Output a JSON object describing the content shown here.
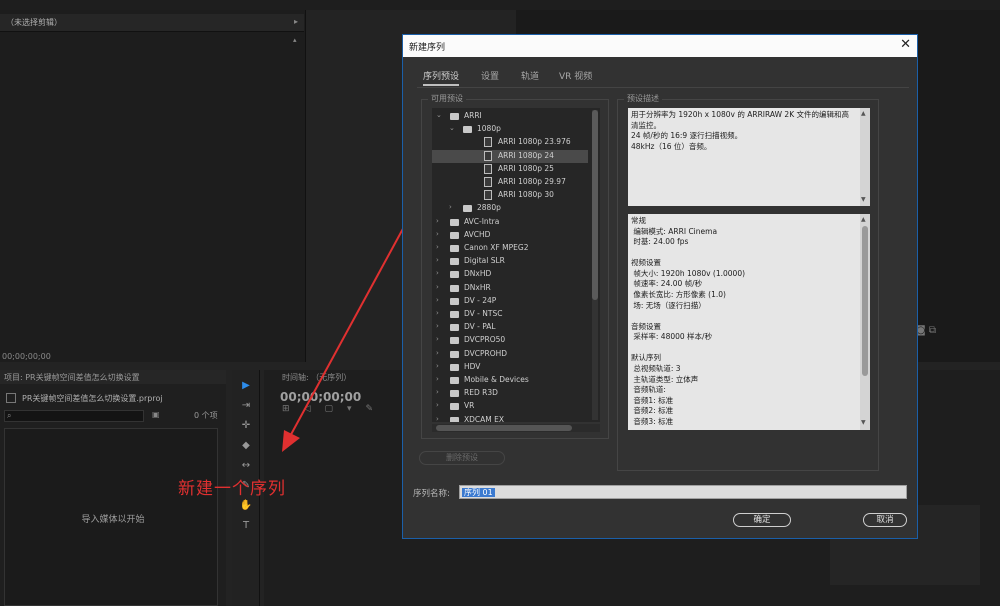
{
  "source_panel": {
    "tab_label": "（未选择剪辑）",
    "timecode": "00;00;00;00"
  },
  "project_panel": {
    "tab_label": "项目: PR关键帧空间差值怎么切换设置",
    "file_name": "PR关键帧空间差值怎么切换设置.prproj",
    "item_count": "0 个项",
    "empty_text": "导入媒体以开始"
  },
  "timeline": {
    "tab_label": "时间轴: （无序列）",
    "timecode": "00;00;00;00"
  },
  "annotation": {
    "text": "新建一个序列",
    "color": "#e03030"
  },
  "dialog": {
    "title": "新建序列",
    "tabs": [
      "序列预设",
      "设置",
      "轨道",
      "VR 视频"
    ],
    "active_tab": 0,
    "available_presets_label": "可用预设",
    "description_label": "预设描述",
    "tree": [
      {
        "label": "ARRI",
        "type": "folder",
        "level": 0,
        "expanded": true
      },
      {
        "label": "1080p",
        "type": "folder",
        "level": 1,
        "expanded": true
      },
      {
        "label": "ARRI 1080p 23.976",
        "type": "file",
        "level": 2
      },
      {
        "label": "ARRI 1080p 24",
        "type": "file",
        "level": 2,
        "selected": true
      },
      {
        "label": "ARRI 1080p 25",
        "type": "file",
        "level": 2
      },
      {
        "label": "ARRI 1080p 29.97",
        "type": "file",
        "level": 2
      },
      {
        "label": "ARRI 1080p 30",
        "type": "file",
        "level": 2
      },
      {
        "label": "2880p",
        "type": "folder",
        "level": 1,
        "expanded": false
      },
      {
        "label": "AVC-Intra",
        "type": "folder",
        "level": 0,
        "expanded": false
      },
      {
        "label": "AVCHD",
        "type": "folder",
        "level": 0,
        "expanded": false
      },
      {
        "label": "Canon XF MPEG2",
        "type": "folder",
        "level": 0,
        "expanded": false
      },
      {
        "label": "Digital SLR",
        "type": "folder",
        "level": 0,
        "expanded": false
      },
      {
        "label": "DNxHD",
        "type": "folder",
        "level": 0,
        "expanded": false
      },
      {
        "label": "DNxHR",
        "type": "folder",
        "level": 0,
        "expanded": false
      },
      {
        "label": "DV - 24P",
        "type": "folder",
        "level": 0,
        "expanded": false
      },
      {
        "label": "DV - NTSC",
        "type": "folder",
        "level": 0,
        "expanded": false
      },
      {
        "label": "DV - PAL",
        "type": "folder",
        "level": 0,
        "expanded": false
      },
      {
        "label": "DVCPRO50",
        "type": "folder",
        "level": 0,
        "expanded": false
      },
      {
        "label": "DVCPROHD",
        "type": "folder",
        "level": 0,
        "expanded": false
      },
      {
        "label": "HDV",
        "type": "folder",
        "level": 0,
        "expanded": false
      },
      {
        "label": "Mobile & Devices",
        "type": "folder",
        "level": 0,
        "expanded": false
      },
      {
        "label": "RED R3D",
        "type": "folder",
        "level": 0,
        "expanded": false
      },
      {
        "label": "VR",
        "type": "folder",
        "level": 0,
        "expanded": false
      },
      {
        "label": "XDCAM EX",
        "type": "folder",
        "level": 0,
        "expanded": false
      }
    ],
    "description_lines": [
      "用于分辨率为 1920h x 1080v 的 ARRIRAW 2K 文件的编辑和高清监控。",
      "24 帧/秒的 16:9 逐行扫描视频。",
      "48kHz（16 位）音频。"
    ],
    "info_lines": [
      "常规",
      " 编辑模式: ARRI Cinema",
      " 时基: 24.00 fps",
      "",
      "视频设置",
      " 帧大小: 1920h 1080v (1.0000)",
      " 帧速率: 24.00 帧/秒",
      " 像素长宽比: 方形像素 (1.0)",
      " 场: 无场（逐行扫描）",
      "",
      "音频设置",
      " 采样率: 48000 样本/秒",
      "",
      "默认序列",
      " 总视频轨道: 3",
      " 主轨道类型: 立体声",
      " 音频轨道:",
      " 音频1: 标准",
      " 音频2: 标准",
      " 音频3: 标准"
    ],
    "delete_preset_label": "删除预设",
    "sequence_name_label": "序列名称:",
    "sequence_name_value": "序列 01",
    "ok_label": "确定",
    "cancel_label": "取消"
  }
}
